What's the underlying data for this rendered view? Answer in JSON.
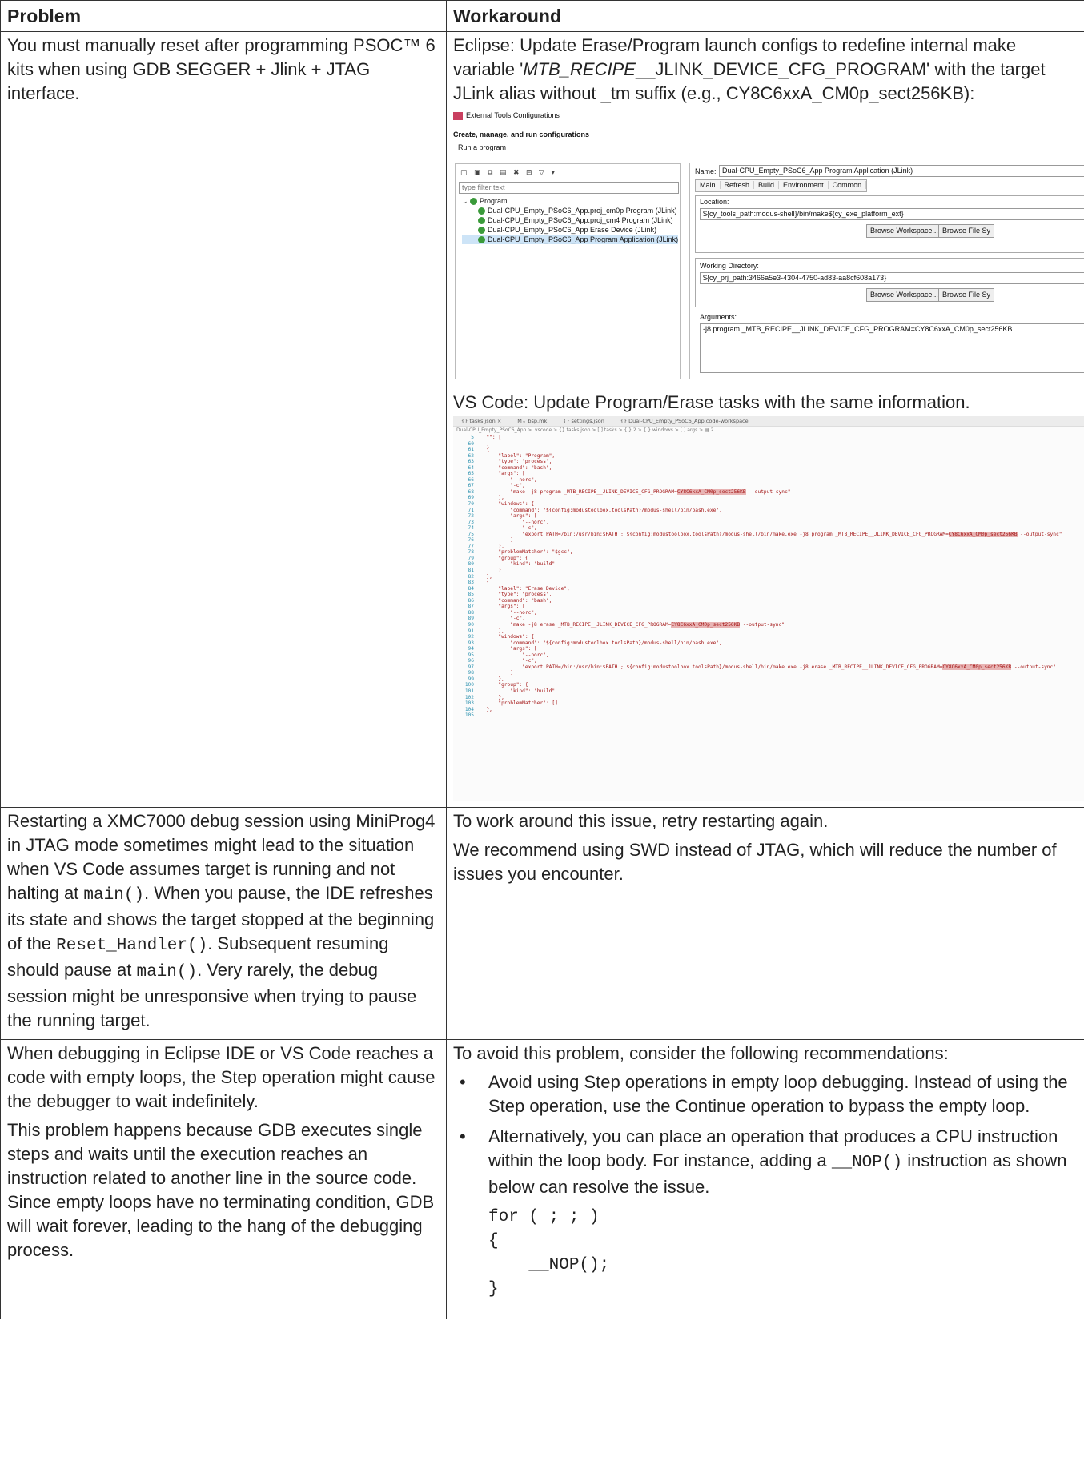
{
  "headers": {
    "problem": "Problem",
    "workaround": "Workaround"
  },
  "row1": {
    "problem": "You must manually reset after programming PSOC™ 6 kits when using GDB SEGGER + Jlink + JTAG interface.",
    "eclipse_text_pre": "Eclipse: Update Erase/Program launch configs to redefine internal make variable '",
    "eclipse_text_italic": "MTB_RECIPE",
    "eclipse_text_post": "__JLINK_DEVICE_CFG_PROGRAM' with the target JLink alias without _tm suffix (e.g., CY8C6xxA_CM0p_sect256KB):",
    "eclipse_screenshot": {
      "title": "External Tools Configurations",
      "heading": "Create, manage, and run configurations",
      "subheading": "Run a program",
      "filter_placeholder": "type filter text",
      "tree_root": "Program",
      "tree_items": [
        "Dual-CPU_Empty_PSoC6_App.proj_cm0p Program (JLink)",
        "Dual-CPU_Empty_PSoC6_App.proj_cm4 Program (JLink)",
        "Dual-CPU_Empty_PSoC6_App Erase Device (JLink)",
        "Dual-CPU_Empty_PSoC6_App Program Application (JLink)"
      ],
      "name_label": "Name:",
      "name_value": "Dual-CPU_Empty_PSoC6_App Program Application (JLink)",
      "tabs": [
        "Main",
        "Refresh",
        "Build",
        "Environment",
        "Common"
      ],
      "location_label": "Location:",
      "location_value": "${cy_tools_path:modus-shell}/bin/make${cy_exe_platform_ext}",
      "browse_workspace": "Browse Workspace...",
      "browse_file": "Browse File Sy",
      "workdir_label": "Working Directory:",
      "workdir_value": "${cy_prj_path:3466a5e3-4304-4750-ad83-aa8cf608a173}",
      "arguments_label": "Arguments:",
      "arguments_value": "-j8 program _MTB_RECIPE__JLINK_DEVICE_CFG_PROGRAM=CY8C6xxA_CM0p_sect256KB"
    },
    "vscode_text": "VS Code: Update Program/Erase tasks with the same information.",
    "vscode_screenshot": {
      "tabs": [
        "{} tasks.json ×",
        "M↓ bsp.mk",
        "{} settings.json",
        "{} Dual-CPU_Empty_PSoC6_App.code-workspace"
      ],
      "breadcrumb": "Dual-CPU_Empty_PSoC6_App > .vscode > {} tasks.json > [ ] tasks > { } 2 > { } windows > [ ] args > ▤ 2",
      "lines": [
        {
          "n": "5",
          "t": "  \"\": ["
        },
        {
          "n": "60",
          "t": "  ,"
        },
        {
          "n": "61",
          "t": "  {"
        },
        {
          "n": "62",
          "t": "      \"label\": \"Program\","
        },
        {
          "n": "63",
          "t": "      \"type\": \"process\","
        },
        {
          "n": "64",
          "t": "      \"command\": \"bash\","
        },
        {
          "n": "65",
          "t": "      \"args\": ["
        },
        {
          "n": "66",
          "t": "          \"--norc\","
        },
        {
          "n": "67",
          "t": "          \"-c\","
        },
        {
          "n": "68",
          "t": "          \"make -j8 program _MTB_RECIPE__JLINK_DEVICE_CFG_PROGRAM=",
          "h": "CY8C6xxA_CM0p_sect256KB",
          "e": " --output-sync\""
        },
        {
          "n": "69",
          "t": "      ],"
        },
        {
          "n": "70",
          "t": "      \"windows\": {"
        },
        {
          "n": "71",
          "t": "          \"command\": \"${config:modustoolbox.toolsPath}/modus-shell/bin/bash.exe\","
        },
        {
          "n": "72",
          "t": "          \"args\": ["
        },
        {
          "n": "73",
          "t": "              \"--norc\","
        },
        {
          "n": "74",
          "t": "              \"-c\","
        },
        {
          "n": "75",
          "t": "              \"export PATH=/bin:/usr/bin:$PATH ; ${config:modustoolbox.toolsPath}/modus-shell/bin/make.exe -j8 program _MTB_RECIPE__JLINK_DEVICE_CFG_PROGRAM=",
          "h": "CY8C6xxA_CM0p_sect256KB",
          "e": " --output-sync\""
        },
        {
          "n": "76",
          "t": "          ]"
        },
        {
          "n": "77",
          "t": "      },"
        },
        {
          "n": "78",
          "t": "      \"problemMatcher\": \"$gcc\","
        },
        {
          "n": "79",
          "t": "      \"group\": {"
        },
        {
          "n": "80",
          "t": "          \"kind\": \"build\""
        },
        {
          "n": "81",
          "t": "      }"
        },
        {
          "n": "82",
          "t": "  },"
        },
        {
          "n": "83",
          "t": "  {"
        },
        {
          "n": "84",
          "t": "      \"label\": \"Erase Device\","
        },
        {
          "n": "85",
          "t": "      \"type\": \"process\","
        },
        {
          "n": "86",
          "t": "      \"command\": \"bash\","
        },
        {
          "n": "87",
          "t": "      \"args\": ["
        },
        {
          "n": "88",
          "t": "          \"--norc\","
        },
        {
          "n": "89",
          "t": "          \"-c\","
        },
        {
          "n": "90",
          "t": "          \"make -j8 erase _MTB_RECIPE__JLINK_DEVICE_CFG_PROGRAM=",
          "h": "CY8C6xxA_CM0p_sect256KB",
          "e": " --output-sync\""
        },
        {
          "n": "91",
          "t": "      ],"
        },
        {
          "n": "92",
          "t": "      \"windows\": {"
        },
        {
          "n": "93",
          "t": "          \"command\": \"${config:modustoolbox.toolsPath}/modus-shell/bin/bash.exe\","
        },
        {
          "n": "94",
          "t": "          \"args\": ["
        },
        {
          "n": "95",
          "t": "              \"--norc\","
        },
        {
          "n": "96",
          "t": "              \"-c\","
        },
        {
          "n": "97",
          "t": "              \"export PATH=/bin:/usr/bin:$PATH ; ${config:modustoolbox.toolsPath}/modus-shell/bin/make.exe -j8 erase _MTB_RECIPE__JLINK_DEVICE_CFG_PROGRAM=",
          "h": "CY8C6xxA_CM0p_sect256KB",
          "e": " --output-sync\""
        },
        {
          "n": "98",
          "t": "          ]"
        },
        {
          "n": "99",
          "t": "      },"
        },
        {
          "n": "100",
          "t": "      \"group\": {"
        },
        {
          "n": "101",
          "t": "          \"kind\": \"build\""
        },
        {
          "n": "102",
          "t": "      },"
        },
        {
          "n": "103",
          "t": "      \"problemMatcher\": []"
        },
        {
          "n": "104",
          "t": "  },"
        },
        {
          "n": "105",
          "t": ""
        }
      ]
    }
  },
  "row2": {
    "problem_1": "Restarting a XMC7000 debug session using MiniProg4 in JTAG mode sometimes might lead to the situation when VS Code assumes target is running and not halting at ",
    "code_main": "main()",
    "problem_2": ". When you pause, the IDE refreshes its state and shows the target stopped at the beginning of the ",
    "code_reset": "Reset_Handler()",
    "problem_3": ". Subsequent resuming should pause at ",
    "problem_4": ". Very rarely, the debug session might be unresponsive when trying to pause the running target.",
    "workaround_1": "To work around this issue, retry restarting again.",
    "workaround_2": "We recommend using SWD instead of JTAG, which will reduce the number of issues you encounter."
  },
  "row3": {
    "problem_1": "When debugging in Eclipse IDE or VS Code reaches a code with empty loops, the Step operation might cause the debugger to wait indefinitely.",
    "problem_2": "This problem happens because GDB executes single steps and waits until the execution reaches an instruction related to another line in the source code. Since empty loops have no terminating condition, GDB will wait forever, leading to the hang of the debugging process.",
    "workaround_intro": "To avoid this problem, consider the following recommendations:",
    "bullet_symbol": "•",
    "bullet_1": "Avoid using Step operations in empty loop debugging. Instead of using the Step operation, use the Continue operation to bypass the empty loop.",
    "bullet_2_pre": "Alternatively, you can place an operation that produces a CPU instruction within the loop body. For instance, adding a ",
    "bullet_2_code": "__NOP()",
    "bullet_2_post": " instruction as shown below can resolve the issue.",
    "code_block": "for ( ; ; )\n{\n    __NOP();\n}"
  }
}
